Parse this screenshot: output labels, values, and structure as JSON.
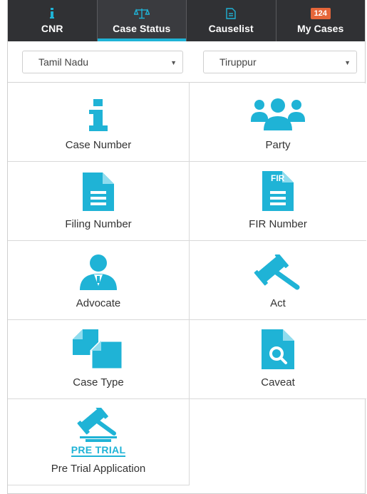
{
  "tabs": [
    {
      "label": "CNR",
      "icon": "info-icon",
      "active": false
    },
    {
      "label": "Case Status",
      "icon": "scales-icon",
      "active": true
    },
    {
      "label": "Causelist",
      "icon": "document-icon",
      "active": false
    },
    {
      "label": "My Cases",
      "icon": "badge-count",
      "badge": "124",
      "active": false
    }
  ],
  "filters": {
    "state": "Tamil Nadu",
    "district": "Tiruppur"
  },
  "options": [
    {
      "label": "Case Number",
      "icon": "info-icon"
    },
    {
      "label": "Party",
      "icon": "group-icon"
    },
    {
      "label": "Filing Number",
      "icon": "document-icon"
    },
    {
      "label": "FIR Number",
      "icon": "fir-document-icon"
    },
    {
      "label": "Advocate",
      "icon": "advocate-icon"
    },
    {
      "label": "Act",
      "icon": "gavel-icon"
    },
    {
      "label": "Case Type",
      "icon": "copy-documents-icon"
    },
    {
      "label": "Caveat",
      "icon": "search-document-icon"
    },
    {
      "label": "Pre Trial Application",
      "icon": "pre-trial-icon",
      "icon_text": "PRE TRIAL"
    }
  ],
  "colors": {
    "accent": "#1fb3d6",
    "tabbar": "#303134",
    "badge": "#e5663a"
  }
}
